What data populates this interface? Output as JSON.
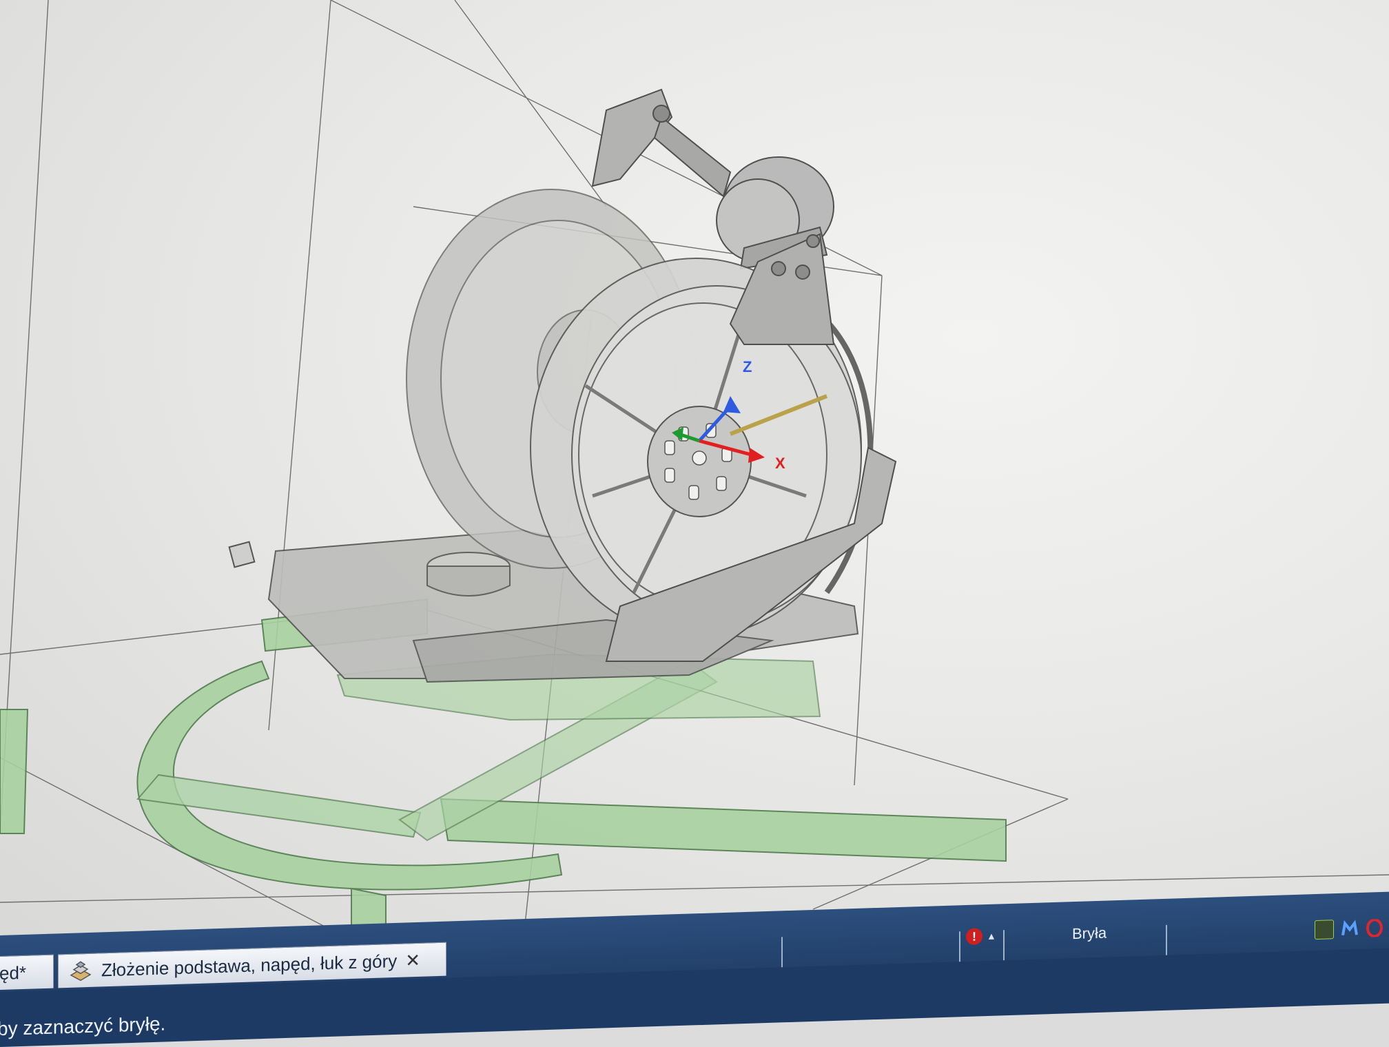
{
  "tabs": {
    "previous_label": "ęd*",
    "active_label": "Złożenie podstawa, napęd, łuk z góry",
    "close_glyph": "✕"
  },
  "status": {
    "warning_glyph": "!",
    "warning_arrow": "▲",
    "mode": "Bryła",
    "message": "by zaznaczyć bryłę."
  },
  "triad": {
    "z_label": "Z",
    "x_label": "X"
  },
  "colors": {
    "viewport_bg": "#e9e9e7",
    "part_gray": "#b9b9b7",
    "part_green": "#9fcf98",
    "axis_x": "#e02020",
    "axis_y": "#1f9a2f",
    "axis_z": "#2f5be0",
    "taskbar": "#1f3d66"
  },
  "tray_icons": [
    "nvidia-icon",
    "malwarebytes-icon",
    "opera-icon"
  ]
}
